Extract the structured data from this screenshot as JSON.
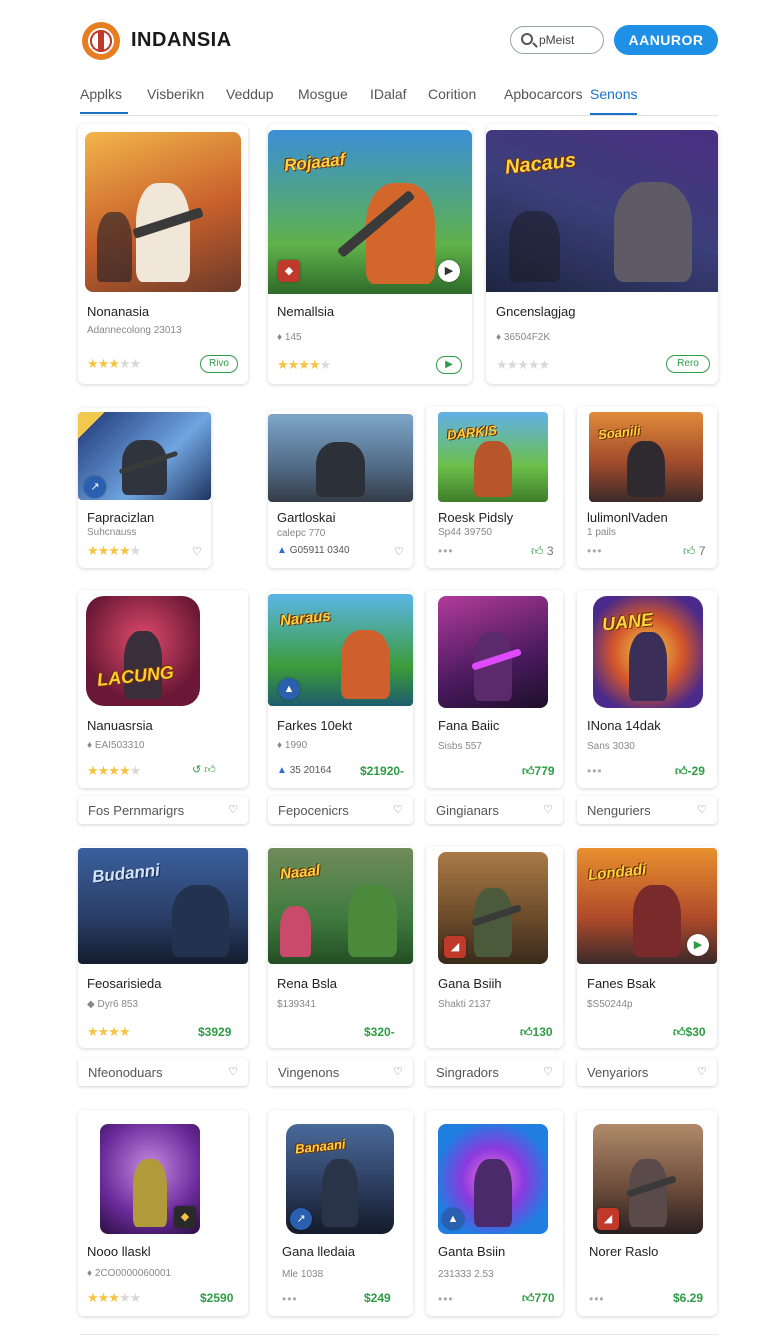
{
  "header": {
    "brand": "INDANSIA",
    "search_placeholder": "pMeist",
    "cta_label": "AANUROR"
  },
  "tabs": [
    "Applks",
    "Visberikn",
    "Veddup",
    "Mosgue",
    "IDalaf",
    "Corition",
    "Apbocarcors",
    "Senons"
  ],
  "active_tab": "Senons",
  "colors": {
    "accent": "#1e90e6",
    "tab_active": "#1a73c7",
    "price": "#2e9c45",
    "star": "#f6c343"
  },
  "row1": [
    {
      "title": "Nonanasia",
      "sub": "Adannecolong 23013",
      "stars": 3,
      "tag": "Rivo"
    },
    {
      "title": "Nemallsia",
      "sub": "145",
      "stars": 4,
      "tag": "▶"
    },
    {
      "title": "Gncenslagjag",
      "sub": "36504F2K",
      "stars": 0,
      "tag": "Rero"
    }
  ],
  "row2": [
    {
      "title": "Fapracizlan",
      "sub": "Suhcnauss",
      "stars": 4,
      "meta": "♡"
    },
    {
      "title": "Gartloskai",
      "sub": "calepc 770",
      "sub2": "G05911 0340",
      "meta": "♡"
    },
    {
      "title": "Roesk Pidsly",
      "sub": "Sp44 39750",
      "meta": "3"
    },
    {
      "title": "lulimonlVaden",
      "sub": "1 pails",
      "meta": "7"
    }
  ],
  "row3": [
    {
      "title": "Nanuasrsia",
      "sub": "EAI503310",
      "stars": 4,
      "meta": ""
    },
    {
      "title": "Farkes 10ekt",
      "sub": "1990",
      "sub2": "35 20164",
      "price": "$21920-"
    },
    {
      "title": "Fana Baiic",
      "sub": "Sisbs 557",
      "price": "779"
    },
    {
      "title": "INona 14dak",
      "sub": "Sans 3030",
      "price": "-29"
    }
  ],
  "bars1": [
    "Fos Pernmarigrs",
    "Fepocenicrs",
    "Gingianars",
    "Nenguriers"
  ],
  "row4": [
    {
      "title": "Feosarisieda",
      "sub": "Dyr6 853",
      "stars": 4,
      "price": "$3929"
    },
    {
      "title": "Rena Bsla",
      "sub": "$139341",
      "price": "$320-"
    },
    {
      "title": "Gana Bsiih",
      "sub": "Shakti 2137",
      "price": "130"
    },
    {
      "title": "Fanes Bsak",
      "sub": "$S50244p",
      "price": "$30"
    }
  ],
  "bars2": [
    "Nfeonoduars",
    "Vingenons",
    "Singradors",
    "Venyariors"
  ],
  "row5": [
    {
      "title": "Nooo llaskl",
      "sub": "2CO0000060001",
      "stars": 3,
      "price": "$2590"
    },
    {
      "title": "Gana lledaia",
      "sub": "Mle 1038",
      "price": "$249"
    },
    {
      "title": "Ganta Bsiin",
      "sub": "231333 2.53",
      "price": "770"
    },
    {
      "title": "Norer Raslo",
      "sub": "",
      "price": "$6.29"
    }
  ]
}
